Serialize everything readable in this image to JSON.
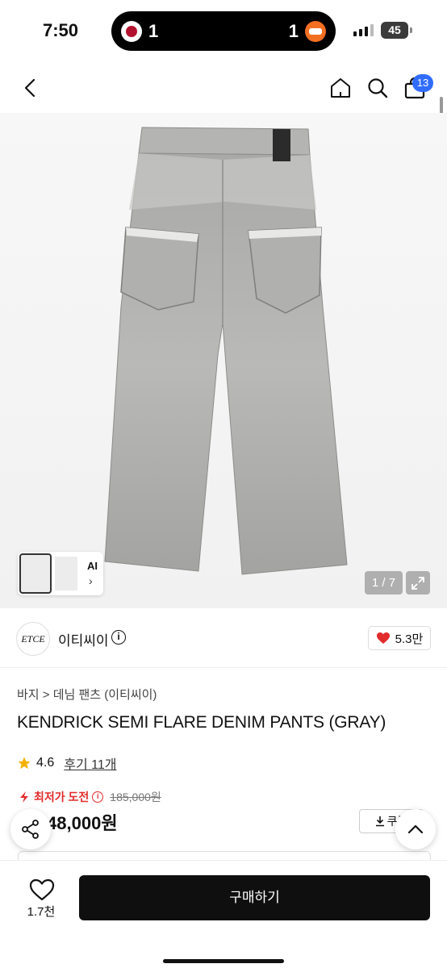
{
  "status": {
    "time": "7:50",
    "score_left": "1",
    "score_right": "1",
    "battery": "45"
  },
  "nav": {
    "cart_count": "13"
  },
  "gallery": {
    "counter": "1 / 7",
    "ai_label": "AI"
  },
  "seller": {
    "logo_text": "ETCE",
    "name": "이티씨이",
    "likes": "5.3만"
  },
  "product": {
    "breadcrumb": "바지 > 데님 팬츠 (이티씨이)",
    "title": "KENDRICK SEMI FLARE DENIM PANTS (GRAY)",
    "rating": "4.6",
    "review_link": "후기 11개",
    "challenge_label": "최저가 도전",
    "original_price": "185,000원",
    "discount": "%",
    "price": "148,000원",
    "coupon_label": "쿠폰"
  },
  "bottom": {
    "likes": "1.7천",
    "buy_label": "구매하기"
  },
  "colors": {
    "accent_red": "#e22b2b",
    "badge_blue": "#2f6cff",
    "buy_bg": "#0f0f0f",
    "star": "#f5b100"
  },
  "icons": [
    "back-icon",
    "home-icon",
    "search-icon",
    "cart-icon",
    "expand-icon",
    "info-icon",
    "heart-icon",
    "star-icon",
    "lightning-icon",
    "download-icon",
    "share-icon",
    "chevron-up-icon"
  ]
}
